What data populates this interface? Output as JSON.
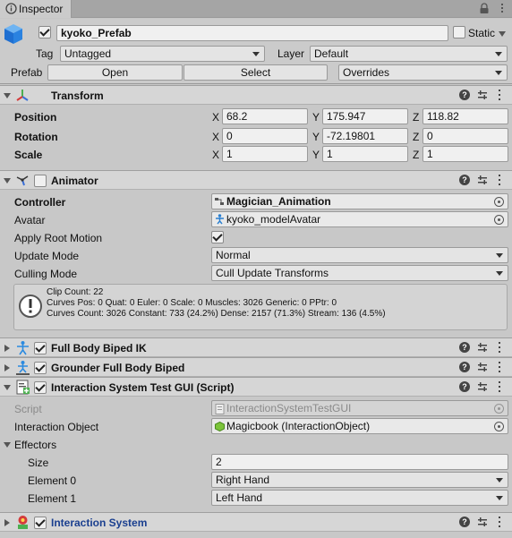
{
  "tab": {
    "title": "Inspector",
    "icon": "info-icon"
  },
  "header": {
    "active_checked": true,
    "name": "kyoko_Prefab",
    "static_label": "Static",
    "static_checked": false,
    "tag_label": "Tag",
    "tag_value": "Untagged",
    "layer_label": "Layer",
    "layer_value": "Default",
    "prefab_label": "Prefab",
    "open_label": "Open",
    "select_label": "Select",
    "overrides_label": "Overrides"
  },
  "transform": {
    "title": "Transform",
    "position_label": "Position",
    "rotation_label": "Rotation",
    "scale_label": "Scale",
    "x_label": "X",
    "y_label": "Y",
    "z_label": "Z",
    "position": {
      "x": "68.2",
      "y": "175.947",
      "z": "118.82"
    },
    "rotation": {
      "x": "0",
      "y": "-72.19801",
      "z": "0"
    },
    "scale": {
      "x": "1",
      "y": "1",
      "z": "1"
    }
  },
  "animator": {
    "title": "Animator",
    "enabled": false,
    "controller_label": "Controller",
    "controller_value": "Magician_Animation",
    "avatar_label": "Avatar",
    "avatar_value": "kyoko_modelAvatar",
    "apply_root_motion_label": "Apply Root Motion",
    "apply_root_motion": true,
    "update_mode_label": "Update Mode",
    "update_mode_value": "Normal",
    "culling_mode_label": "Culling Mode",
    "culling_mode_value": "Cull Update Transforms",
    "info_lines": [
      "Clip Count: 22",
      "Curves Pos: 0 Quat: 0 Euler: 0 Scale: 0 Muscles: 3026 Generic: 0 PPtr: 0",
      "Curves Count: 3026 Constant: 733 (24.2%) Dense: 2157 (71.3%) Stream: 136 (4.5%)"
    ]
  },
  "full_body_biped_ik": {
    "title": "Full Body Biped IK",
    "enabled": true
  },
  "grounder": {
    "title": "Grounder Full Body Biped",
    "enabled": true
  },
  "interaction_test_gui": {
    "title": "Interaction System Test GUI (Script)",
    "enabled": true,
    "script_label": "Script",
    "script_value": "InteractionSystemTestGUI",
    "interaction_object_label": "Interaction Object",
    "interaction_object_value": "Magicbook (InteractionObject)",
    "effectors_label": "Effectors",
    "size_label": "Size",
    "size_value": "2",
    "elements": [
      {
        "label": "Element 0",
        "value": "Right Hand"
      },
      {
        "label": "Element 1",
        "value": "Left Hand"
      }
    ]
  },
  "interaction_system": {
    "title": "Interaction System",
    "enabled": true,
    "title_color": "#1a3f8f"
  },
  "colors": {
    "panel_bg": "#c8c8c8",
    "header_bg": "#d6d6d6",
    "field_bg": "#f0f0f0",
    "accent": "#2a5db0"
  }
}
